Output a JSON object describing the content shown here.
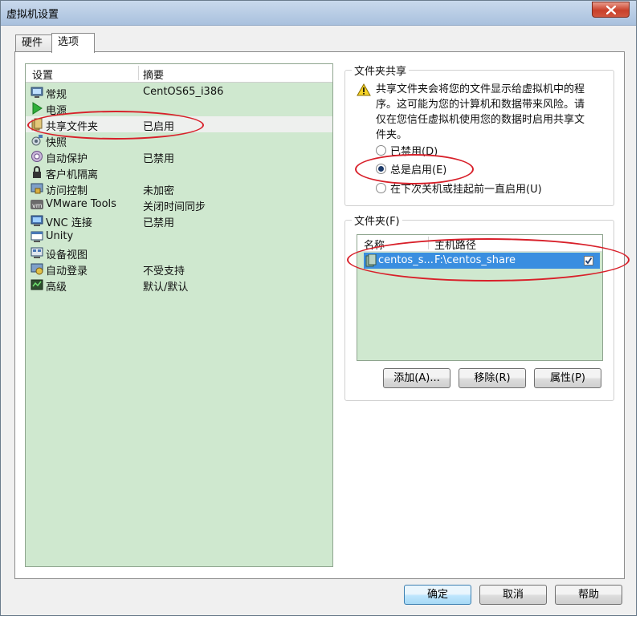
{
  "window": {
    "title": "虚拟机设置"
  },
  "tabs": [
    {
      "label": "硬件",
      "active": false
    },
    {
      "label": "选项",
      "active": true
    }
  ],
  "settings": {
    "headers": {
      "setting": "设置",
      "summary": "摘要"
    },
    "items": [
      {
        "name": "常规",
        "summary": "CentOS65_i386",
        "icon": "general-icon"
      },
      {
        "name": "电源",
        "summary": "",
        "icon": "power-icon"
      },
      {
        "name": "共享文件夹",
        "summary": "已启用",
        "icon": "shared-folder-icon",
        "selected": true
      },
      {
        "name": "快照",
        "summary": "",
        "icon": "snapshot-icon"
      },
      {
        "name": "自动保护",
        "summary": "已禁用",
        "icon": "autoprotect-icon"
      },
      {
        "name": "客户机隔离",
        "summary": "",
        "icon": "guest-isolation-icon"
      },
      {
        "name": "访问控制",
        "summary": "未加密",
        "icon": "access-control-icon"
      },
      {
        "name": "VMware Tools",
        "summary": "关闭时间同步",
        "icon": "vmware-tools-icon"
      },
      {
        "name": "VNC 连接",
        "summary": "已禁用",
        "icon": "vnc-icon"
      },
      {
        "name": "Unity",
        "summary": "",
        "icon": "unity-icon"
      },
      {
        "name": "设备视图",
        "summary": "",
        "icon": "device-view-icon"
      },
      {
        "name": "自动登录",
        "summary": "不受支持",
        "icon": "autologin-icon"
      },
      {
        "name": "高级",
        "summary": "默认/默认",
        "icon": "advanced-icon"
      }
    ]
  },
  "folder_sharing": {
    "title": "文件夹共享",
    "warning": "共享文件夹会将您的文件显示给虚拟机中的程序。这可能为您的计算机和数据带来风险。请仅在您信任虚拟机使用您的数据时启用共享文件夹。",
    "options": [
      {
        "label": "已禁用(D)",
        "checked": false
      },
      {
        "label": "总是启用(E)",
        "checked": true
      },
      {
        "label": "在下次关机或挂起前一直启用(U)",
        "checked": false
      }
    ]
  },
  "folders": {
    "title": "文件夹(F)",
    "headers": {
      "name": "名称",
      "host_path": "主机路径"
    },
    "rows": [
      {
        "name": "centos_s...",
        "host_path": "F:\\centos_share",
        "enabled": true
      }
    ],
    "buttons": {
      "add": "添加(A)...",
      "remove": "移除(R)",
      "properties": "属性(P)"
    }
  },
  "dialog_buttons": {
    "ok": "确定",
    "cancel": "取消",
    "help": "帮助"
  },
  "colors": {
    "list_bg": "#cfe8cf",
    "selection": "#3a8ee0",
    "annotation": "#d8202a"
  }
}
